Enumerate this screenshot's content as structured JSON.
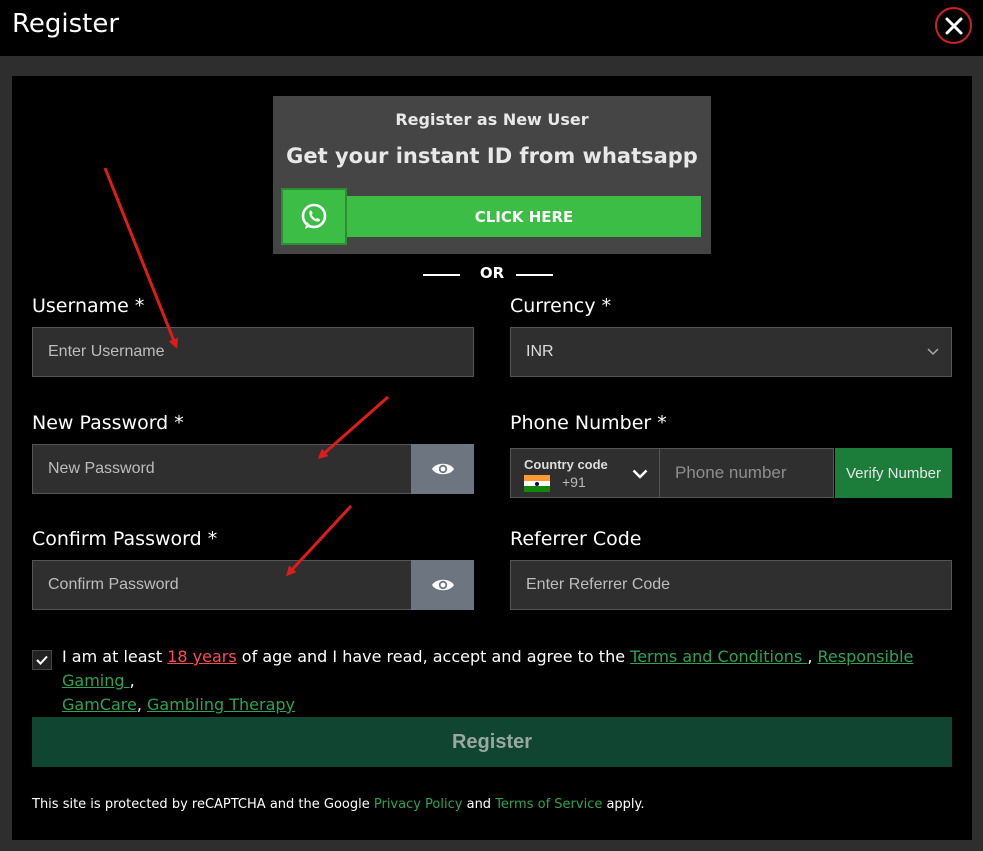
{
  "header": {
    "title": "Register"
  },
  "whatsapp": {
    "subtitle": "Register as New User",
    "headline": "Get your instant ID from whatsapp",
    "button_label": "CLICK HERE"
  },
  "divider": {
    "or_text": "OR"
  },
  "form": {
    "username": {
      "label": "Username *",
      "placeholder": "Enter Username",
      "value": ""
    },
    "currency": {
      "label": "Currency *",
      "selected": "INR"
    },
    "new_password": {
      "label": "New Password *",
      "placeholder": "New Password",
      "value": ""
    },
    "phone": {
      "label": "Phone Number *",
      "country_label": "Country code",
      "country_code": "+91",
      "placeholder": "Phone number",
      "verify_label": "Verify Number"
    },
    "confirm_password": {
      "label": "Confirm Password *",
      "placeholder": "Confirm Password",
      "value": ""
    },
    "referrer": {
      "label": "Referrer Code",
      "placeholder": "Enter Referrer Code",
      "value": ""
    }
  },
  "agreement": {
    "checked": true,
    "text_1": "I am at least ",
    "age_link": "18 years",
    "text_2": " of age and I have read, accept and agree to the ",
    "terms_link": "Terms and Conditions ",
    "sep_1": ", ",
    "responsible_link": "Responsible Gaming ",
    "sep_2": ",",
    "gamcare_link": "GamCare",
    "sep_3": ", ",
    "therapy_link": "Gambling Therapy"
  },
  "register_button": "Register",
  "recaptcha": {
    "text_1": "This site is protected by reCAPTCHA and the Google ",
    "privacy_link": "Privacy Policy",
    "text_2": " and ",
    "terms_link": "Terms of Service",
    "text_3": " apply."
  },
  "icons": {
    "close": "close-icon",
    "whatsapp": "whatsapp-icon",
    "eye": "eye-icon",
    "chevron": "chevron-down-icon",
    "flag": "india-flag-icon",
    "check": "check-icon"
  },
  "colors": {
    "whatsapp_green": "#3cbe46",
    "verify_green": "#1c7c3a",
    "register_green": "#0f4531",
    "link_green": "#2ea44f",
    "link_red": "#ff4d4d",
    "close_red": "#d32020",
    "annotation_arrow": "#e01b1b"
  }
}
